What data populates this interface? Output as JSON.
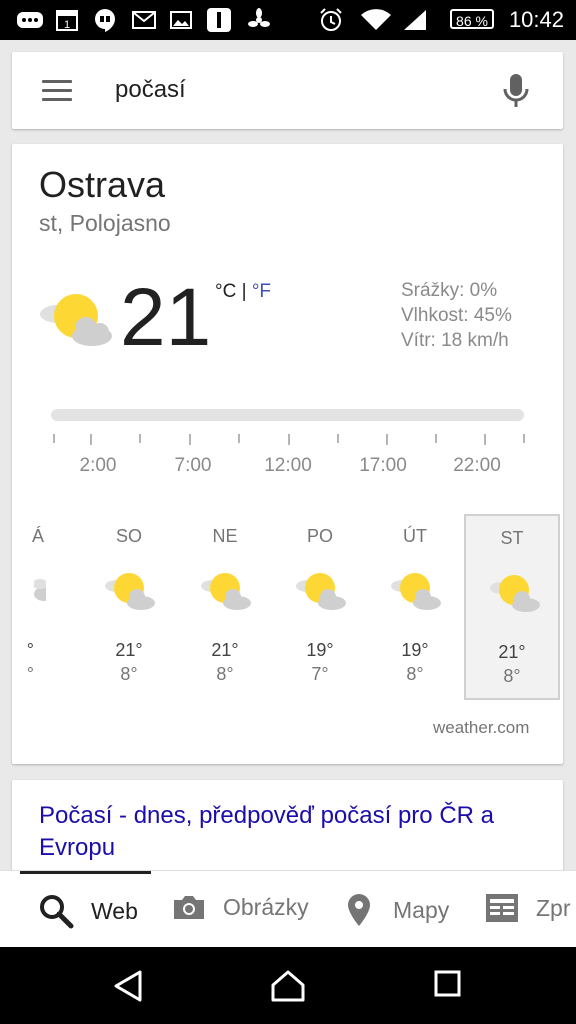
{
  "status_bar": {
    "time": "10:42",
    "battery": "86 %",
    "calendar_day": "1",
    "icons": [
      "chat-icon",
      "calendar-icon",
      "hangouts-icon",
      "gmail-icon",
      "gallery-icon",
      "app-icon",
      "fan-icon",
      "alarm-icon",
      "wifi-icon",
      "signal-icon",
      "battery-icon"
    ]
  },
  "search": {
    "query": "počasí"
  },
  "weather": {
    "city": "Ostrava",
    "condition": "st, Polojasno",
    "temperature": "21",
    "unit_c": "°C",
    "unit_sep": "|",
    "unit_f": "°F",
    "precipitation": "Srážky: 0%",
    "humidity": "Vlhkost: 45%",
    "wind": "Vítr: 18 km/h",
    "hours": [
      "2:00",
      "7:00",
      "12:00",
      "17:00",
      "22:00"
    ],
    "days": [
      {
        "name": "Á",
        "hi": "°",
        "lo": "°"
      },
      {
        "name": "SO",
        "hi": "21°",
        "lo": "8°"
      },
      {
        "name": "NE",
        "hi": "21°",
        "lo": "8°"
      },
      {
        "name": "PO",
        "hi": "19°",
        "lo": "7°"
      },
      {
        "name": "ÚT",
        "hi": "19°",
        "lo": "8°"
      },
      {
        "name": "ST",
        "hi": "21°",
        "lo": "8°"
      }
    ],
    "source": "weather.com"
  },
  "result": {
    "title": "Počasí - dnes, předpověď počasí pro ČR a Evropu"
  },
  "tabs": [
    {
      "label": "Web",
      "icon": "search-icon"
    },
    {
      "label": "Obrázky",
      "icon": "camera-icon"
    },
    {
      "label": "Mapy",
      "icon": "map-pin-icon"
    },
    {
      "label": "Zpr",
      "icon": "news-icon"
    }
  ],
  "colors": {
    "link": "#1a0dab",
    "fahrenheit": "#3f51b5",
    "sun": "#fdd835"
  }
}
